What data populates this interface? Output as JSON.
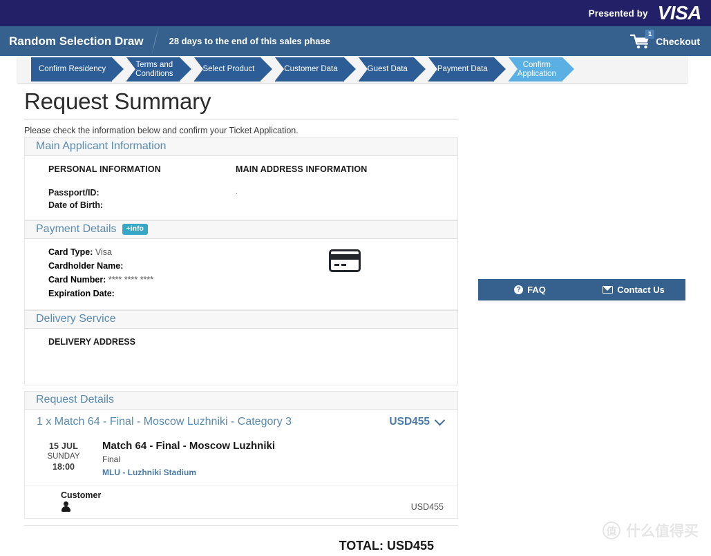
{
  "topbar": {
    "presented_by": "Presented by",
    "brand": "VISA"
  },
  "phasebar": {
    "draw_title": "Random Selection Draw",
    "phase_message": "28 days to the end of this sales phase",
    "cart_badge": "1",
    "checkout_label": "Checkout"
  },
  "steps": [
    {
      "label": "Confirm Residency",
      "active": false
    },
    {
      "label": "Terms and\nConditions",
      "active": false
    },
    {
      "label": "Select Product",
      "active": false
    },
    {
      "label": "Customer Data",
      "active": false
    },
    {
      "label": "Guest Data",
      "active": false
    },
    {
      "label": "Payment Data",
      "active": false
    },
    {
      "label": "Confirm\nApplication",
      "active": true
    }
  ],
  "page": {
    "title": "Request Summary",
    "intro": "Please check the information below and confirm your Ticket Application."
  },
  "applicant": {
    "section_title": "Main Applicant Information",
    "personal_heading": "PERSONAL INFORMATION",
    "address_heading": "MAIN ADDRESS INFORMATION",
    "fields": [
      {
        "key": "Passport/ID:",
        "value": ""
      },
      {
        "key": "Date of Birth:",
        "value": ""
      }
    ],
    "address_value": "."
  },
  "payment": {
    "section_title": "Payment Details",
    "info_badge": "+info",
    "card_type_key": "Card Type:",
    "card_type_value": "Visa",
    "cardholder_key": "Cardholder Name:",
    "cardholder_value": "",
    "card_number_key": "Card Number:",
    "card_number_value": "**** **** ****",
    "expiration_key": "Expiration Date:",
    "expiration_value": ""
  },
  "delivery": {
    "section_title": "Delivery Service",
    "address_heading": "DELIVERY ADDRESS"
  },
  "request_details": {
    "section_title": "Request Details",
    "item_title": "1 x Match 64 - Final - Moscow Luzhniki - Category 3",
    "item_price": "USD455",
    "match": {
      "day": "15 JUL",
      "weekday": "SUNDAY",
      "time": "18:00",
      "title": "Match 64 - Final - Moscow Luzhniki",
      "stage": "Final",
      "venue": "MLU - Luzhniki Stadium"
    },
    "customer_label": "Customer",
    "customer_amount": "USD455",
    "total": "TOTAL: USD455"
  },
  "help": {
    "faq_label": "FAQ",
    "faq_icon_glyph": "?",
    "contact_label": "Contact Us"
  },
  "watermark": {
    "mark": "值",
    "text": "什么值得买"
  },
  "colors": {
    "navy": "#222168",
    "phase_blue": "#36618e",
    "step_blue": "#2c5d96",
    "step_active": "#5ab0e2",
    "section_title": "#5a8ab0",
    "info_badge": "#36a7c6",
    "price": "#4a7ba8"
  }
}
